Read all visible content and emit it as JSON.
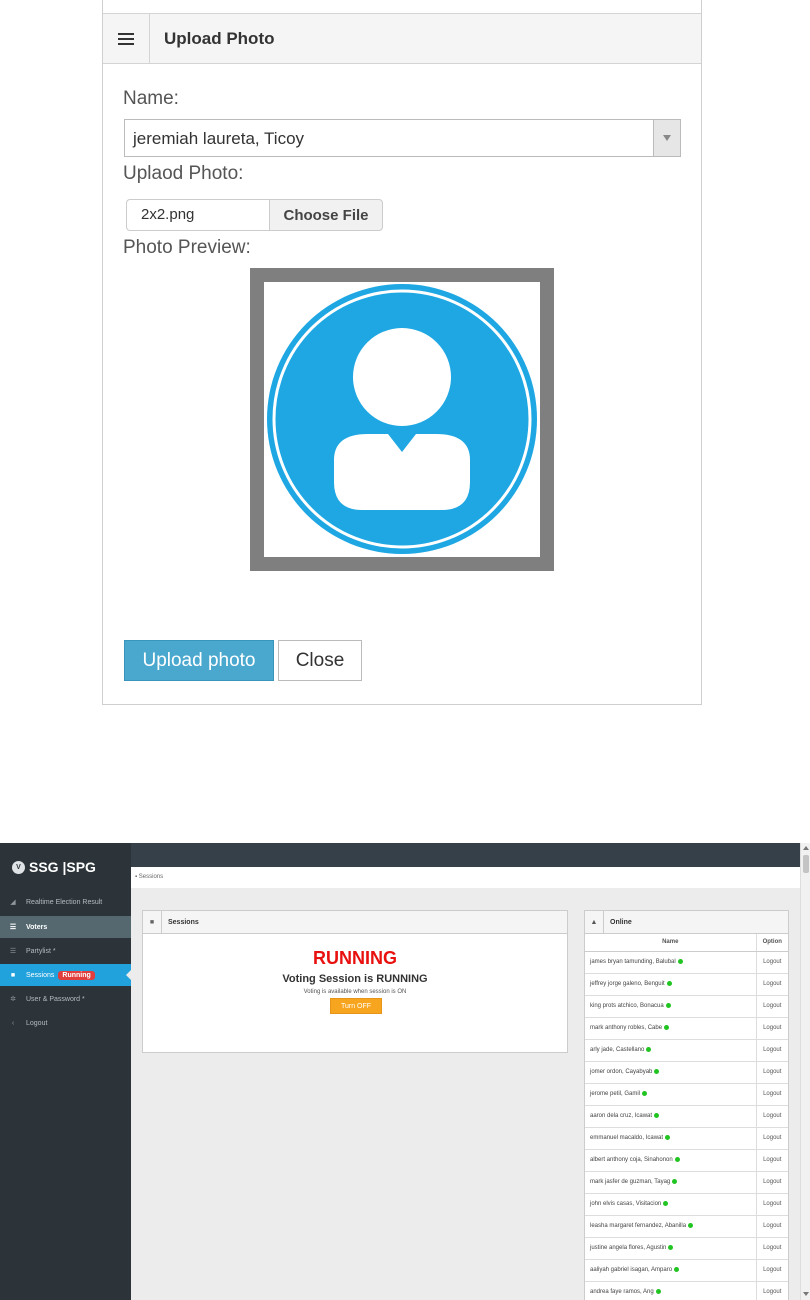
{
  "upload_dialog": {
    "title": "Upload Photo",
    "name_label": "Name:",
    "selected_name": "jeremiah laureta, Ticoy",
    "upload_label": "Uplaod Photo:",
    "file_name": "2x2.png",
    "choose_file_label": "Choose File",
    "preview_label": "Photo Preview:",
    "upload_button": "Upload photo",
    "close_button": "Close",
    "avatar_color": "#1ea7e3"
  },
  "admin": {
    "logo_text": "SSG |SPG",
    "logo_mark": "V",
    "sidebar": {
      "items": [
        {
          "label": "Realtime Election Result",
          "icon": "signal-icon"
        },
        {
          "label": "Voters",
          "icon": "list-icon"
        },
        {
          "label": "Partylist *",
          "icon": "list-icon"
        },
        {
          "label": "Sessions",
          "icon": "lock-icon",
          "badge": "Running"
        },
        {
          "label": "User & Password *",
          "icon": "gear-icon"
        },
        {
          "label": "Logout",
          "icon": "chevron-left-icon"
        }
      ]
    },
    "breadcrumb": "Sessions",
    "sessions_panel": {
      "title": "Sessions",
      "status_big": "RUNNING",
      "status_line": "Voting Session is RUNNING",
      "note": "Voting is available when session is ON",
      "toggle_button": "Turn OFF",
      "status_color": "#e8110f"
    },
    "online_panel": {
      "title": "Online",
      "col_name": "Name",
      "col_option": "Option",
      "rows": [
        {
          "name": "james bryan tamunding, Balubal",
          "option": "Logout"
        },
        {
          "name": "jeffrey jorge galeno, Benguit",
          "option": "Logout"
        },
        {
          "name": "king prots atchico, Bonacua",
          "option": "Logout"
        },
        {
          "name": "mark anthony robles, Cabe",
          "option": "Logout"
        },
        {
          "name": "arly jade, Castellano",
          "option": "Logout"
        },
        {
          "name": "jomer ordon, Cayabyab",
          "option": "Logout"
        },
        {
          "name": "jerome petil, Gamil",
          "option": "Logout"
        },
        {
          "name": "aaron dela cruz, Icawat",
          "option": "Logout"
        },
        {
          "name": "emmanuel macaldo, Icawat",
          "option": "Logout"
        },
        {
          "name": "albert anthony coja, Sinahonon",
          "option": "Logout"
        },
        {
          "name": "mark jasfer de guzman, Tayag",
          "option": "Logout"
        },
        {
          "name": "john elvis casas, Visitacion",
          "option": "Logout"
        },
        {
          "name": "leasha margaret fernandez, Abanilla",
          "option": "Logout"
        },
        {
          "name": "justine angela flores, Agustin",
          "option": "Logout"
        },
        {
          "name": "aaliyah gabriel isagan, Amparo",
          "option": "Logout"
        },
        {
          "name": "andrea faye ramos, Ang",
          "option": "Logout"
        }
      ]
    },
    "online_dot_color": "#21c421"
  }
}
